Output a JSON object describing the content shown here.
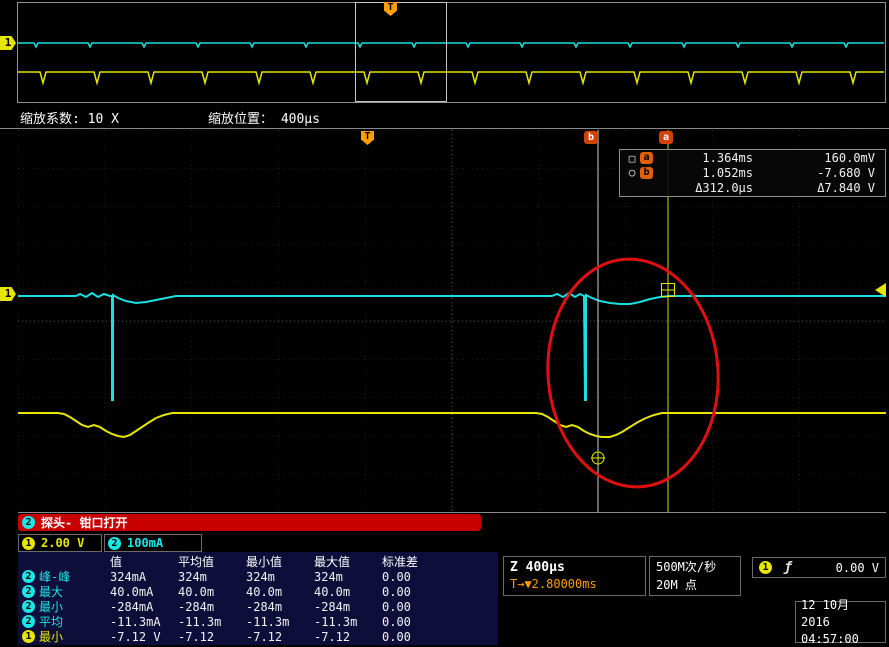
{
  "colors": {
    "ch1": "#e6e600",
    "ch2": "#19e6e6",
    "trigger": "#ffa000",
    "alert": "#c80000"
  },
  "overview": {
    "channel_marker": "1",
    "trigger_marker": "T"
  },
  "zoom_bar": {
    "factor": "缩放系数: 10 X",
    "position": "缩放位置： 400µs"
  },
  "main": {
    "trigger_marker": "T",
    "channel_marker": "1",
    "cursor_a_flag": "a",
    "cursor_b_flag": "b"
  },
  "cursor_readout": {
    "a_symbol": "□",
    "a_label": "a",
    "a_time": "1.364ms",
    "a_value": "160.0mV",
    "b_symbol": "○",
    "b_label": "b",
    "b_time": "1.052ms",
    "b_value": "-7.680 V",
    "delta_time": "Δ312.0µs",
    "delta_value": "Δ7.840 V"
  },
  "probe_alert": {
    "channel": "2",
    "text": "探头- 钳口打开"
  },
  "channel_scales": [
    {
      "num": "1",
      "value": "2.00 V"
    },
    {
      "num": "2",
      "value": "100mA"
    }
  ],
  "measurements": {
    "headers": [
      "值",
      "平均值",
      "最小值",
      "最大值",
      "标准差"
    ],
    "rows": [
      {
        "ch": "2",
        "name": "峰-峰",
        "v": [
          "324mA",
          "324m",
          "324m",
          "324m",
          "0.00"
        ]
      },
      {
        "ch": "2",
        "name": "最大",
        "v": [
          "40.0mA",
          "40.0m",
          "40.0m",
          "40.0m",
          "0.00"
        ]
      },
      {
        "ch": "2",
        "name": "最小",
        "v": [
          "-284mA",
          "-284m",
          "-284m",
          "-284m",
          "0.00"
        ]
      },
      {
        "ch": "2",
        "name": "平均",
        "v": [
          "-11.3mA",
          "-11.3m",
          "-11.3m",
          "-11.3m",
          "0.00"
        ]
      },
      {
        "ch": "1",
        "name": "最小",
        "v": [
          "-7.12 V",
          "-7.12",
          "-7.12",
          "-7.12",
          "0.00"
        ]
      }
    ]
  },
  "timebase": {
    "zoom": "Z 400µs",
    "delay": "T→▼2.80000ms"
  },
  "acquisition": {
    "rate": "500M次/秒",
    "points": "20M 点"
  },
  "trigger": {
    "channel": "1",
    "slope": "ƒ",
    "level": "0.00 V"
  },
  "datetime": {
    "date": "12 10月 2016",
    "time": "04:57:00"
  }
}
